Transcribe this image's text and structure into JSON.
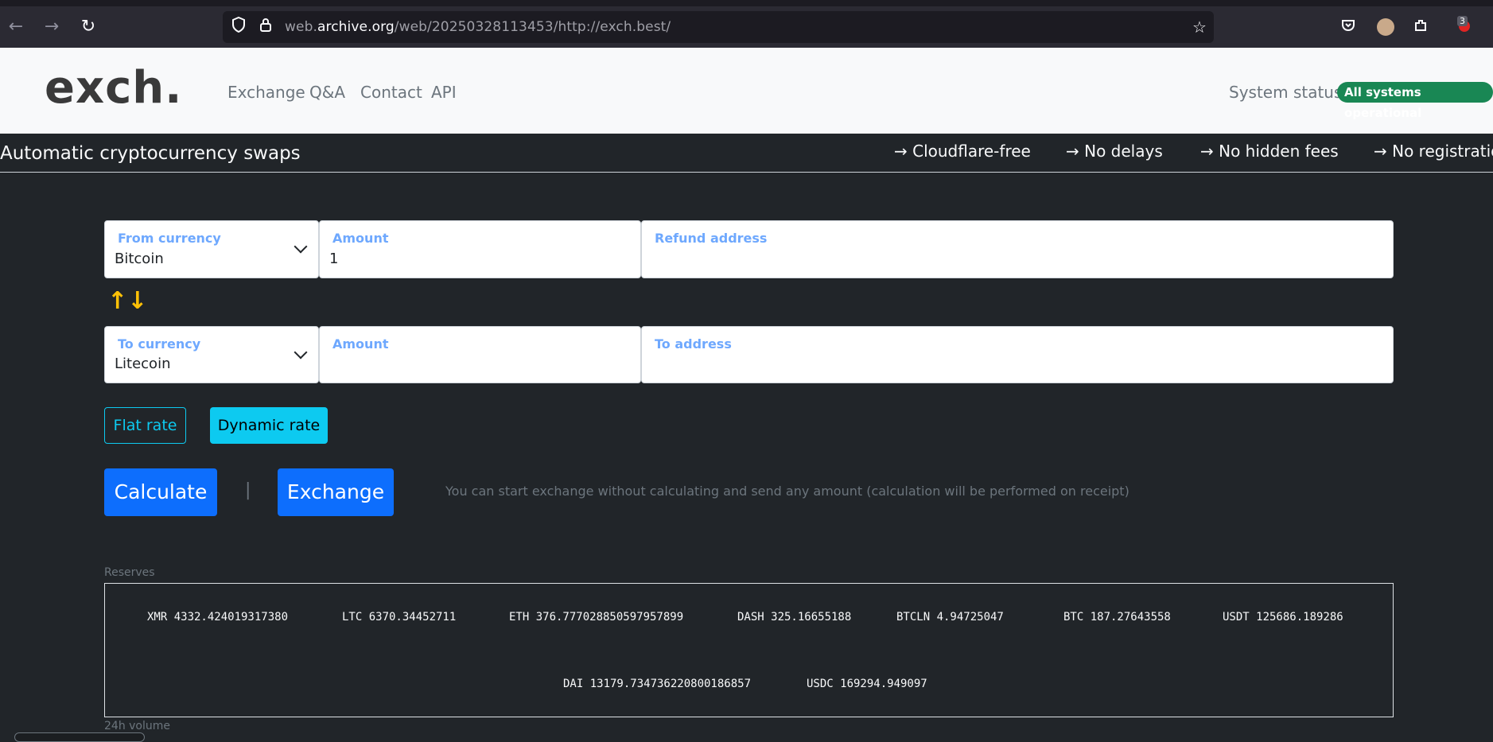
{
  "browser": {
    "url_prefix": "web.",
    "url_domain": "archive.org",
    "url_rest": "/web/20250328113453/http://exch.best/",
    "ext_badge": "3",
    "icons": [
      "back-icon",
      "forward-icon",
      "reload-icon",
      "shield-icon",
      "lock-icon",
      "star-icon",
      "pocket-icon",
      "avatar",
      "extensions-icon",
      "ublock-icon"
    ]
  },
  "header": {
    "logo": "exch.",
    "menu": [
      "Exchange",
      "Q&A",
      "Contact",
      "API"
    ],
    "system_status_label": "System status",
    "system_status_badge": "All systems operational"
  },
  "banner": {
    "title": "Automatic cryptocurrency swaps",
    "features": [
      "→ Cloudflare-free",
      "→ No delays",
      "→ No hidden fees",
      "→ No registration"
    ]
  },
  "form": {
    "from_currency_label": "From currency",
    "from_currency_value": "Bitcoin",
    "from_amount_label": "Amount",
    "from_amount_value": "1",
    "refund_label": "Refund address",
    "refund_value": "",
    "swap_icon": "↑↓",
    "to_currency_label": "To currency",
    "to_currency_value": "Litecoin",
    "to_amount_label": "Amount",
    "to_amount_value": "",
    "to_address_label": "To address",
    "to_address_value": ""
  },
  "rates": {
    "flat": "Flat rate",
    "dynamic": "Dynamic rate"
  },
  "actions": {
    "calculate": "Calculate",
    "separator": "|",
    "exchange": "Exchange",
    "hint": "You can start exchange without calculating and send any amount (calculation will be performed on receipt)"
  },
  "reserves": {
    "label": "Reserves",
    "row1": [
      "XMR 4332.424019317380",
      "LTC 6370.34452711",
      "ETH 376.777028850597957899",
      "DASH 325.16655188",
      "BTCLN 4.94725047",
      "BTC 187.27643558",
      "USDT 125686.189286"
    ],
    "row2": [
      "DAI 13179.734736220800186857",
      "USDC 169294.949097"
    ]
  },
  "volume": {
    "label": "24h volume"
  },
  "colors": {
    "page_bg": "#212529",
    "primary": "#0d6efd",
    "info": "#0dcaf0",
    "success": "#198754",
    "warning": "#ffc107",
    "label_blue": "#6ea8fe"
  }
}
